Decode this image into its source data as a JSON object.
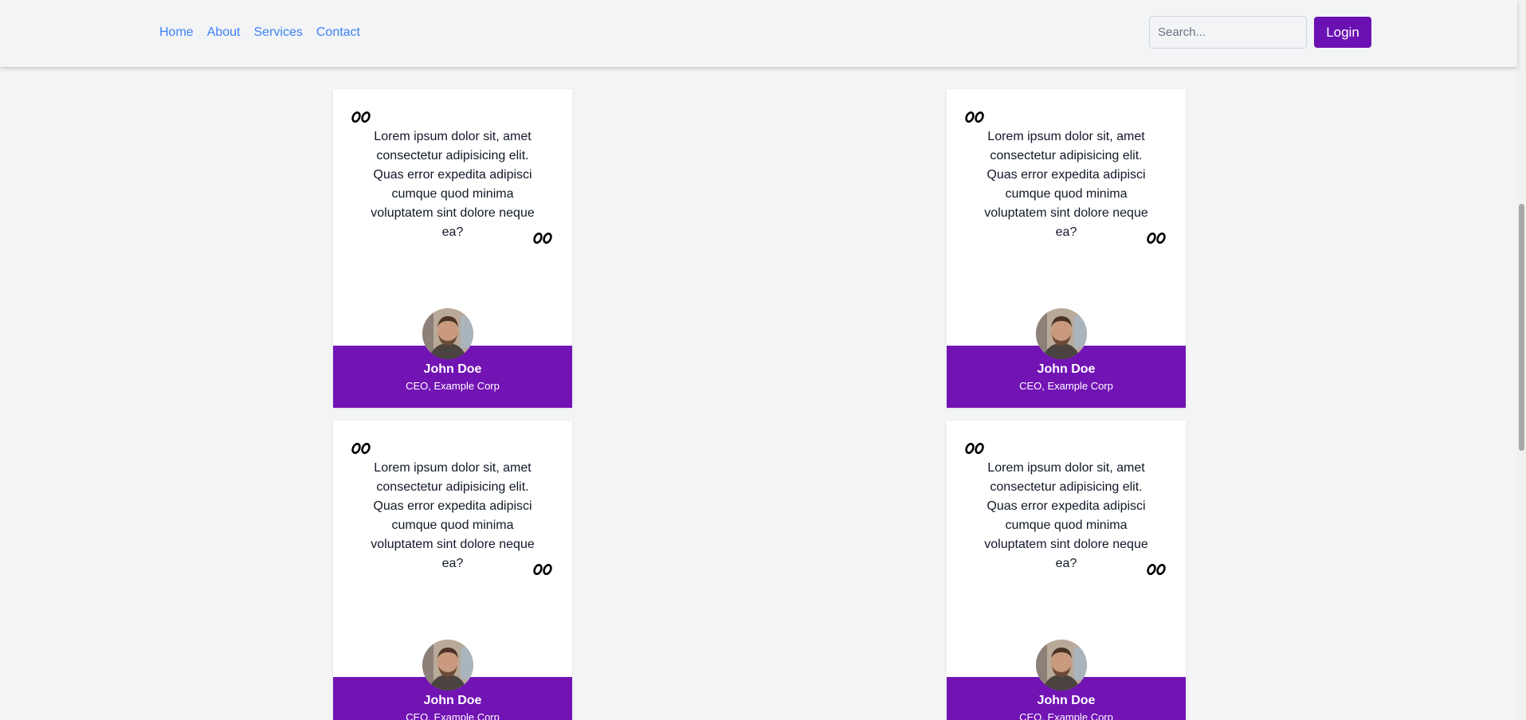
{
  "navbar": {
    "links": [
      "Home",
      "About",
      "Services",
      "Contact"
    ],
    "search": {
      "placeholder": "Search...",
      "value": ""
    },
    "login_label": "Login"
  },
  "colors": {
    "accent": "#7213b4",
    "link": "#3b82f6",
    "background": "#f3f4f6"
  },
  "testimonials": [
    {
      "quote": "Lorem ipsum dolor sit, amet consectetur adipisicing elit. Quas error expedita adipisci cumque quod minima voluptatem sint dolore neque ea?",
      "name": "John Doe",
      "role": "CEO, Example Corp"
    },
    {
      "quote": "Lorem ipsum dolor sit, amet consectetur adipisicing elit. Quas error expedita adipisci cumque quod minima voluptatem sint dolore neque ea?",
      "name": "John Doe",
      "role": "CEO, Example Corp"
    },
    {
      "quote": "Lorem ipsum dolor sit, amet consectetur adipisicing elit. Quas error expedita adipisci cumque quod minima voluptatem sint dolore neque ea?",
      "name": "John Doe",
      "role": "CEO, Example Corp"
    },
    {
      "quote": "Lorem ipsum dolor sit, amet consectetur adipisicing elit. Quas error expedita adipisci cumque quod minima voluptatem sint dolore neque ea?",
      "name": "John Doe",
      "role": "CEO, Example Corp"
    }
  ]
}
